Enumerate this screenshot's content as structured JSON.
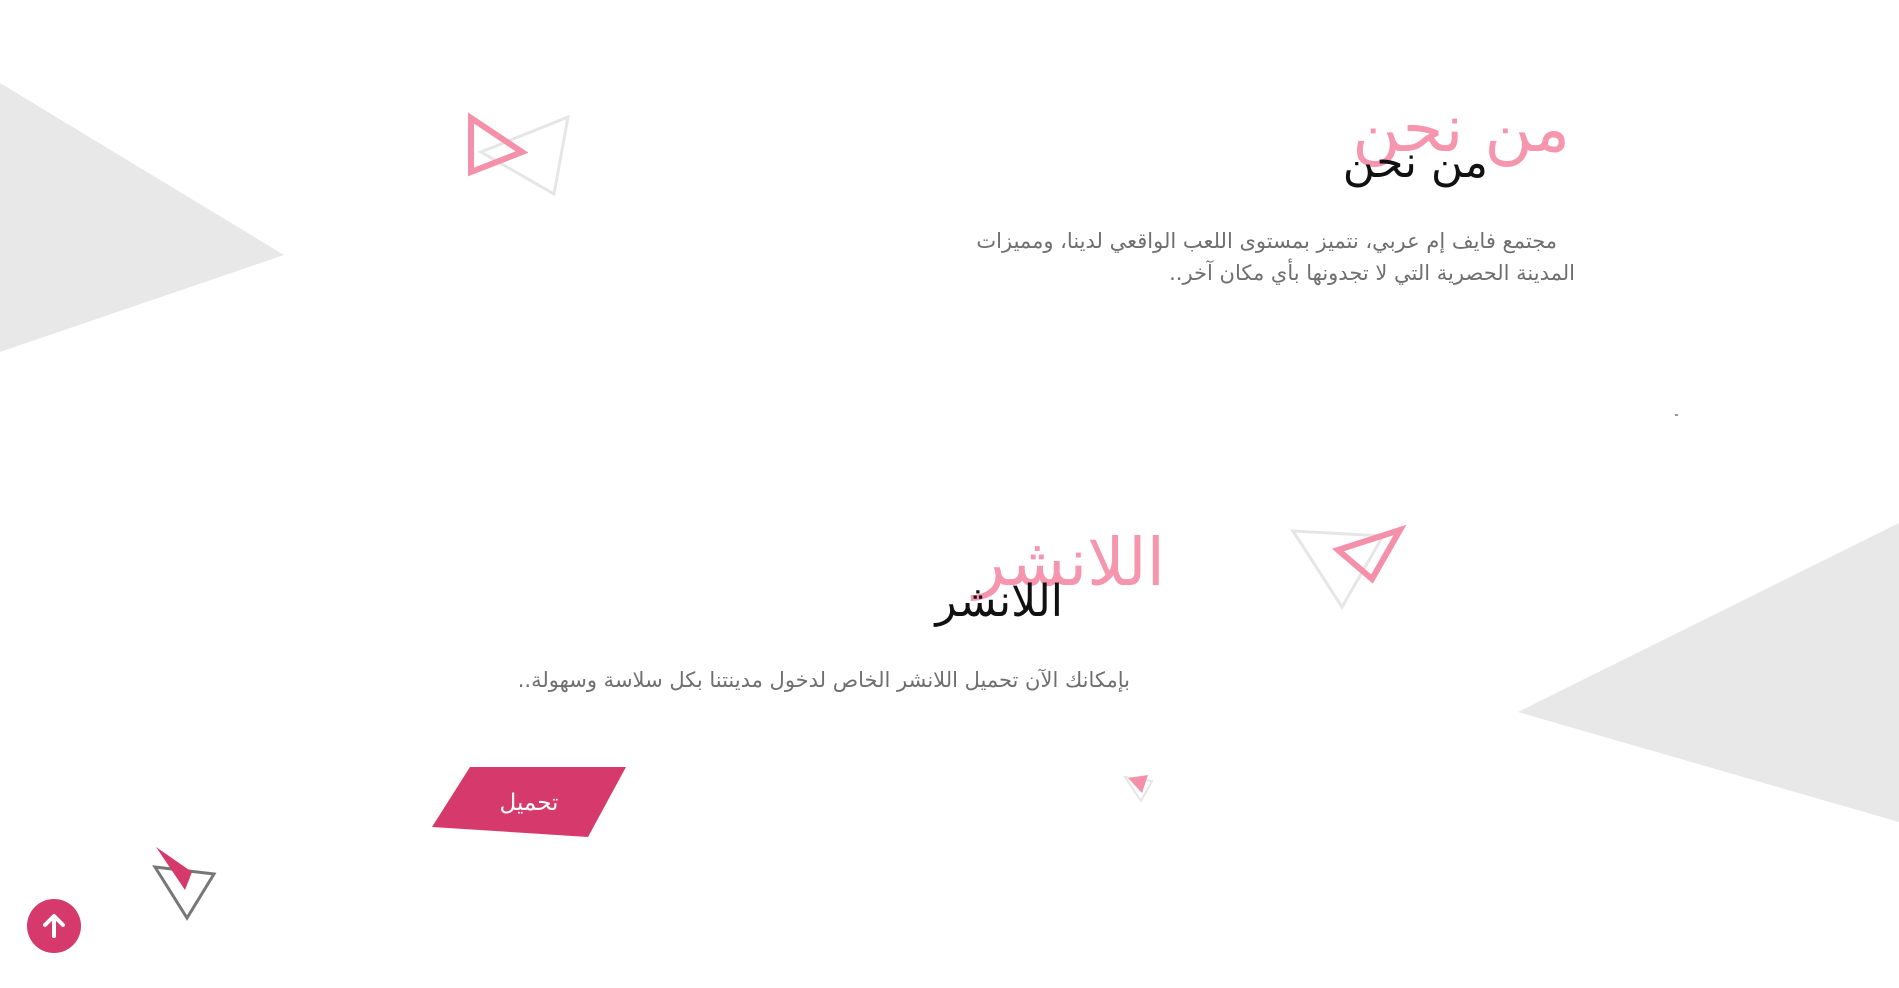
{
  "colors": {
    "accent": "#d63a6c",
    "accent_light": "#f590aa",
    "decor_gray": "#e8e8e8",
    "text_gray": "#6f6f6f",
    "heading_dark": "#111111",
    "background": "#ffffff"
  },
  "about": {
    "title_bg": "من نحن",
    "title": "من نحن",
    "description_line1": "مجتمع فايف إم عربي، نتميز بمستوى اللعب الواقعي لدينا، ومميزات",
    "description_line2": "المدينة الحصرية التي لا تجدونها بأي مكان آخر.."
  },
  "launcher": {
    "title_bg": "اللانشر",
    "title": "اللانشر",
    "description": "بإمكانك الآن تحميل اللانشر الخاص لدخول مدينتنا بكل سلاسة وسهولة..",
    "download_label": "تحميل"
  },
  "scroll_top": {
    "icon": "arrow-up-icon"
  }
}
